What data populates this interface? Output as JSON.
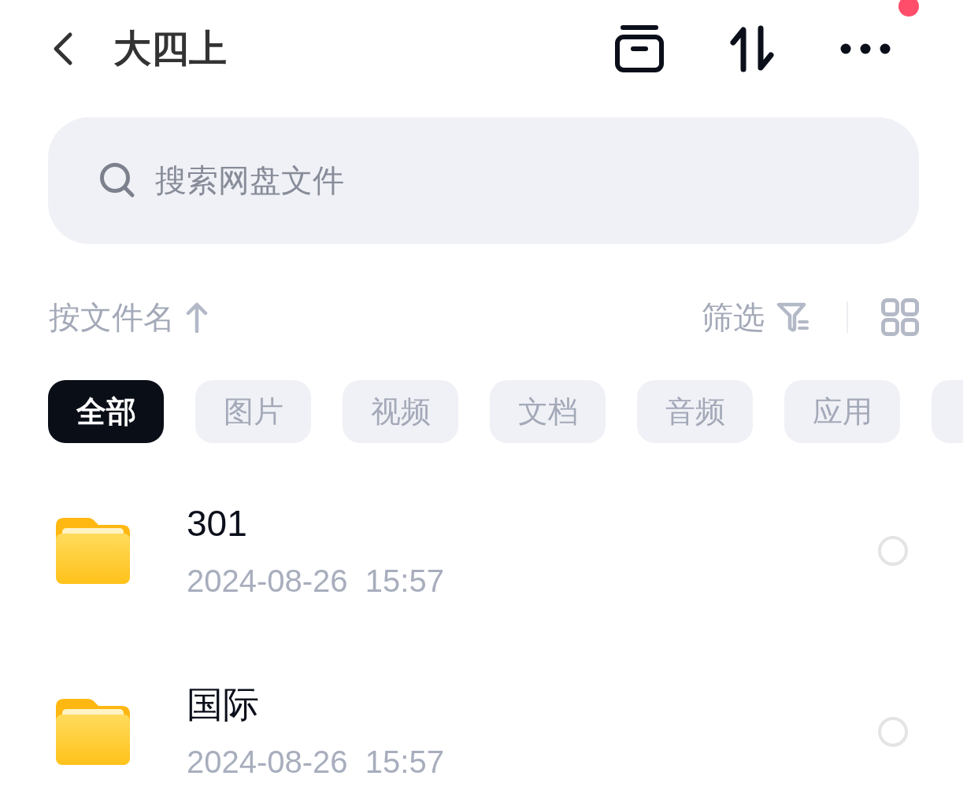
{
  "header": {
    "title": "大四上",
    "notification_dot": true
  },
  "search": {
    "placeholder": "搜索网盘文件"
  },
  "toolbar": {
    "sort_label": "按文件名",
    "filter_label": "筛选"
  },
  "chips": [
    {
      "label": "全部",
      "selected": true
    },
    {
      "label": "图片",
      "selected": false
    },
    {
      "label": "视频",
      "selected": false
    },
    {
      "label": "文档",
      "selected": false
    },
    {
      "label": "音频",
      "selected": false
    },
    {
      "label": "应用",
      "selected": false
    },
    {
      "selected": false
    }
  ],
  "files": [
    {
      "name": "301",
      "modified": "2024-08-26  15:57",
      "selected": false
    },
    {
      "name": "国际",
      "modified": "2024-08-26  15:57",
      "selected": false
    }
  ]
}
